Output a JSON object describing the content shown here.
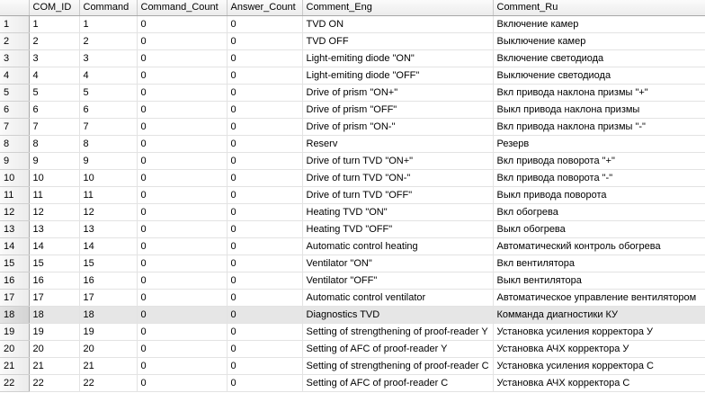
{
  "columns": [
    "",
    "COM_ID",
    "Command",
    "Command_Count",
    "Answer_Count",
    "Comment_Eng",
    "Comment_Ru"
  ],
  "selected_row": 18,
  "rows": [
    {
      "n": "1",
      "id": "1",
      "cmd": "1",
      "cc": "0",
      "ac": "0",
      "eng": "TVD ON",
      "ru": "Включение камер"
    },
    {
      "n": "2",
      "id": "2",
      "cmd": "2",
      "cc": "0",
      "ac": "0",
      "eng": "TVD OFF",
      "ru": "Выключение камер"
    },
    {
      "n": "3",
      "id": "3",
      "cmd": "3",
      "cc": "0",
      "ac": "0",
      "eng": "Light-emiting diode \"ON\"",
      "ru": "Включение светодиода"
    },
    {
      "n": "4",
      "id": "4",
      "cmd": "4",
      "cc": "0",
      "ac": "0",
      "eng": "Light-emiting diode \"OFF\"",
      "ru": "Выключение светодиода"
    },
    {
      "n": "5",
      "id": "5",
      "cmd": "5",
      "cc": "0",
      "ac": "0",
      "eng": "Drive of prism \"ON+\"",
      "ru": "Вкл привода наклона призмы \"+\""
    },
    {
      "n": "6",
      "id": "6",
      "cmd": "6",
      "cc": "0",
      "ac": "0",
      "eng": "Drive of prism \"OFF\"",
      "ru": "Выкл привода наклона призмы"
    },
    {
      "n": "7",
      "id": "7",
      "cmd": "7",
      "cc": "0",
      "ac": "0",
      "eng": "Drive of prism \"ON-\"",
      "ru": "Вкл привода наклона призмы \"-\""
    },
    {
      "n": "8",
      "id": "8",
      "cmd": "8",
      "cc": "0",
      "ac": "0",
      "eng": "Reserv",
      "ru": "Резерв"
    },
    {
      "n": "9",
      "id": "9",
      "cmd": "9",
      "cc": "0",
      "ac": "0",
      "eng": "Drive of turn TVD \"ON+\"",
      "ru": "Вкл привода поворота \"+\""
    },
    {
      "n": "10",
      "id": "10",
      "cmd": "10",
      "cc": "0",
      "ac": "0",
      "eng": "Drive of turn TVD \"ON-\"",
      "ru": "Вкл привода поворота \"-\""
    },
    {
      "n": "11",
      "id": "11",
      "cmd": "11",
      "cc": "0",
      "ac": "0",
      "eng": "Drive of turn TVD \"OFF\"",
      "ru": "Выкл привода поворота"
    },
    {
      "n": "12",
      "id": "12",
      "cmd": "12",
      "cc": "0",
      "ac": "0",
      "eng": "Heating TVD \"ON\"",
      "ru": "Вкл обогрева"
    },
    {
      "n": "13",
      "id": "13",
      "cmd": "13",
      "cc": "0",
      "ac": "0",
      "eng": "Heating TVD \"OFF\"",
      "ru": "Выкл обогрева"
    },
    {
      "n": "14",
      "id": "14",
      "cmd": "14",
      "cc": "0",
      "ac": "0",
      "eng": "Automatic control heating",
      "ru": "Автоматический контроль обогрева"
    },
    {
      "n": "15",
      "id": "15",
      "cmd": "15",
      "cc": "0",
      "ac": "0",
      "eng": "Ventilator \"ON\"",
      "ru": "Вкл вентилятора"
    },
    {
      "n": "16",
      "id": "16",
      "cmd": "16",
      "cc": "0",
      "ac": "0",
      "eng": "Ventilator \"OFF\"",
      "ru": "Выкл вентилятора"
    },
    {
      "n": "17",
      "id": "17",
      "cmd": "17",
      "cc": "0",
      "ac": "0",
      "eng": "Automatic control ventilator",
      "ru": "Автоматическое управление вентилятором"
    },
    {
      "n": "18",
      "id": "18",
      "cmd": "18",
      "cc": "0",
      "ac": "0",
      "eng": "Diagnostics TVD",
      "ru": "Комманда диагностики КУ"
    },
    {
      "n": "19",
      "id": "19",
      "cmd": "19",
      "cc": "0",
      "ac": "0",
      "eng": "Setting of strengthening of proof-reader Y",
      "ru": "Установка усиления корректора У"
    },
    {
      "n": "20",
      "id": "20",
      "cmd": "20",
      "cc": "0",
      "ac": "0",
      "eng": "Setting of AFC of proof-reader Y",
      "ru": "Установка АЧХ корректора У"
    },
    {
      "n": "21",
      "id": "21",
      "cmd": "21",
      "cc": "0",
      "ac": "0",
      "eng": "Setting of strengthening of proof-reader C",
      "ru": "Установка усиления корректора С"
    },
    {
      "n": "22",
      "id": "22",
      "cmd": "22",
      "cc": "0",
      "ac": "0",
      "eng": "Setting of AFC of proof-reader C",
      "ru": "Установка АЧХ корректора С"
    }
  ]
}
